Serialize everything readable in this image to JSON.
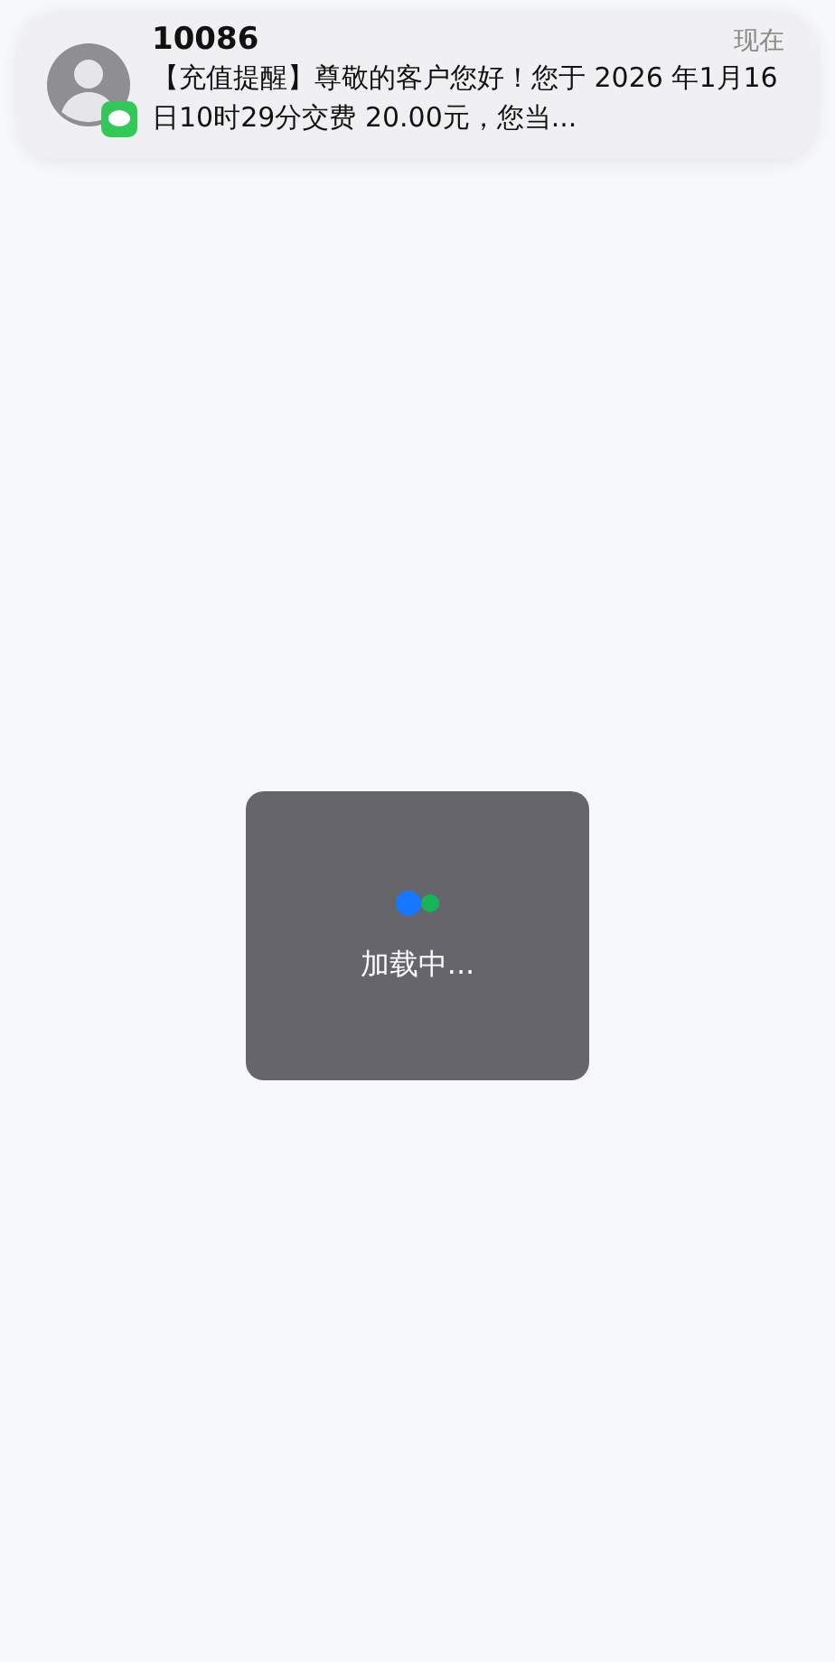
{
  "notification": {
    "sender": "10086",
    "time": "现在",
    "message": "【充值提醒】尊敬的客户您好！您于 2026 年1月16日10时29分交费 20.00元，您当..."
  },
  "loading": {
    "text": "加载中..."
  }
}
